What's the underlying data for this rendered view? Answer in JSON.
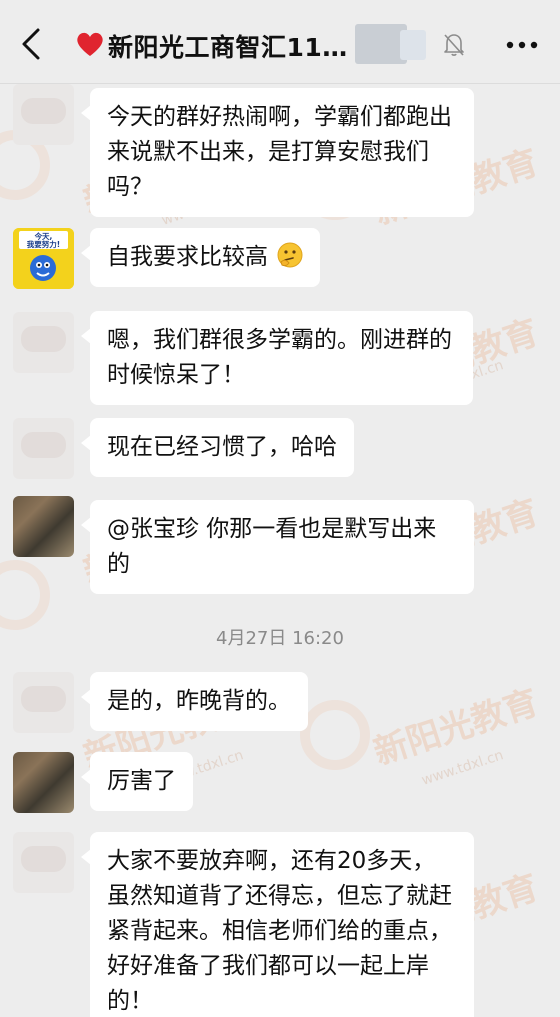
{
  "header": {
    "title": "新阳光工商智汇11…"
  },
  "messages": [
    {
      "text": "今天的群好热闹啊，学霸们都跑出来说默不出来，是打算安慰我们吗？"
    },
    {
      "text": "自我要求比较高",
      "emoji": "thinking-emoji",
      "avatar_text": "今天，我要努力！"
    },
    {
      "text": "嗯，我们群很多学霸的。刚进群的时候惊呆了！"
    },
    {
      "text": "现在已经习惯了，哈哈"
    },
    {
      "text": "@张宝珍 你那一看也是默写出来的"
    },
    {
      "text": "是的，昨晚背的。"
    },
    {
      "text": "厉害了"
    },
    {
      "text": "大家不要放弃啊，还有20多天，虽然知道背了还得忘，但忘了就赶紧背起来。相信老师们给的重点，好好准备了我们都可以一起上岸的！"
    }
  ],
  "timestamp": "4月27日 16:20",
  "watermark": {
    "brand": "新阳光教育",
    "url": "www.tdxl.cn"
  },
  "colors": {
    "background": "#ededed",
    "bubble": "#ffffff",
    "watermark": "#f0a070"
  }
}
